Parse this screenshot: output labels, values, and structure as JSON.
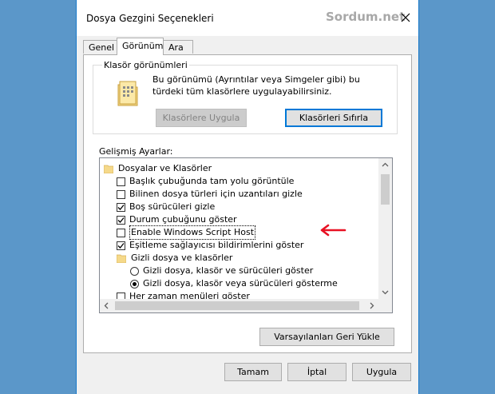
{
  "window": {
    "title": "Dosya Gezgini Seçenekleri",
    "watermark": "Sordum.net"
  },
  "tabs": [
    {
      "label": "Genel"
    },
    {
      "label": "Görünüm"
    },
    {
      "label": "Ara"
    }
  ],
  "folder_views": {
    "title": "Klasör görünümleri",
    "description": "Bu görünümü (Ayrıntılar veya Simgeler gibi) bu türdeki tüm klasörlere uygulayabilirsiniz.",
    "apply_label": "Klasörlere Uygula",
    "reset_label": "Klasörleri Sıfırla"
  },
  "advanced": {
    "label": "Gelişmiş Ayarlar:",
    "items": [
      {
        "type": "folder",
        "label": "Dosyalar ve Klasörler"
      },
      {
        "type": "checkbox",
        "label": "Başlık çubuğunda tam yolu görüntüle",
        "checked": false
      },
      {
        "type": "checkbox",
        "label": "Bilinen dosya türleri için uzantıları gizle",
        "checked": false
      },
      {
        "type": "checkbox",
        "label": "Boş sürücüleri gizle",
        "checked": true
      },
      {
        "type": "checkbox",
        "label": "Durum çubuğunu göster",
        "checked": true
      },
      {
        "type": "checkbox",
        "label": "Enable Windows Script Host",
        "checked": false
      },
      {
        "type": "checkbox",
        "label": "Eşitleme sağlayıcısı bildirimlerini göster",
        "checked": true
      },
      {
        "type": "folder",
        "label": "Gizli dosya ve klasörler"
      },
      {
        "type": "radio",
        "label": "Gizli dosya, klasör ve sürücüleri göster",
        "checked": false
      },
      {
        "type": "radio",
        "label": "Gizli dosya, klasör veya sürücüleri gösterme",
        "checked": true
      },
      {
        "type": "checkbox",
        "label": "Her zaman menüleri göster",
        "checked": false
      }
    ]
  },
  "restore_defaults_label": "Varsayılanları Geri Yükle",
  "footer": {
    "ok_label": "Tamam",
    "cancel_label": "İptal",
    "apply_label": "Uygula"
  },
  "colors": {
    "desktop": "#5b97c9",
    "accent": "#0078d7",
    "arrow": "#e81123"
  }
}
